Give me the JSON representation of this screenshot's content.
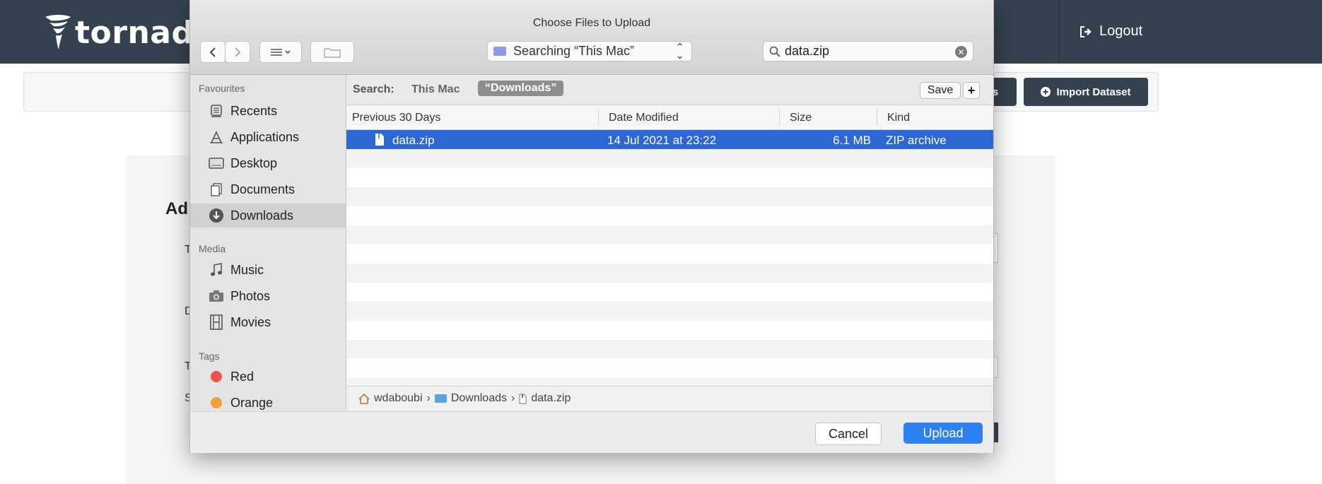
{
  "app": {
    "logo_text": "tornado",
    "logout_label": "Logout",
    "import_label": "Import Dataset",
    "partial_button_text": "s",
    "heading_partial": "Ad",
    "peek_letters": [
      "T",
      "D",
      "T",
      "S"
    ]
  },
  "dialog": {
    "title": "Choose Files to Upload",
    "scope_dropdown": "Searching “This Mac”",
    "search_value": "data.zip",
    "search_scope": {
      "label": "Search:",
      "option_this_mac": "This Mac",
      "option_downloads": "“Downloads”",
      "save_label": "Save",
      "add_label": "+"
    },
    "sidebar": {
      "favourites_header": "Favourites",
      "favourites": [
        "Recents",
        "Applications",
        "Desktop",
        "Documents",
        "Downloads"
      ],
      "media_header": "Media",
      "media": [
        "Music",
        "Photos",
        "Movies"
      ],
      "tags_header": "Tags",
      "tags": [
        "Red",
        "Orange"
      ],
      "tag_colors": [
        "#e8544b",
        "#f0a23a"
      ]
    },
    "columns": [
      "Previous 30 Days",
      "Date Modified",
      "Size",
      "Kind"
    ],
    "files": [
      {
        "name": "data.zip",
        "date": "14 Jul 2021 at 23:22",
        "size": "6.1 MB",
        "kind": "ZIP archive"
      }
    ],
    "path": [
      "wdaboubi",
      "Downloads",
      "data.zip"
    ],
    "path_separator": "›",
    "cancel_label": "Cancel",
    "upload_label": "Upload"
  },
  "colors": {
    "nav": "#36414f",
    "selection": "#2d67d6",
    "primary_button": "#2d81f0"
  }
}
